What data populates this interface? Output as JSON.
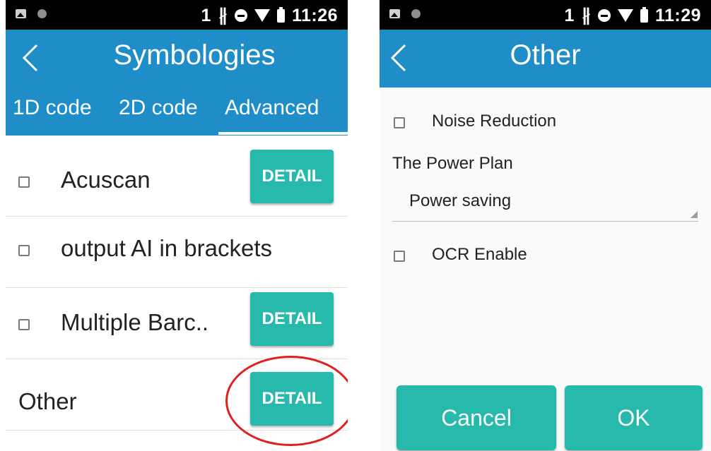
{
  "left": {
    "status": {
      "sim": "1",
      "time": "11:26"
    },
    "toolbar": {
      "title": "Symbologies"
    },
    "tabs": [
      "1D code",
      "2D code",
      "Advanced"
    ],
    "items": [
      {
        "label": "Acuscan",
        "has_checkbox": true,
        "button": "DETAIL"
      },
      {
        "label": "output AI in brackets",
        "has_checkbox": true,
        "button": ""
      },
      {
        "label": "Multiple Barc..",
        "has_checkbox": true,
        "button": "DETAIL"
      },
      {
        "label": "Other",
        "has_checkbox": false,
        "button": "DETAIL"
      }
    ],
    "highlight_color": "#e02020"
  },
  "right": {
    "status": {
      "sim": "1",
      "time": "11:29"
    },
    "toolbar": {
      "title": "Other"
    },
    "noise_reduction_label": "Noise Reduction",
    "power_plan_label": "The Power Plan",
    "power_plan_value": "Power saving",
    "ocr_label": "OCR Enable",
    "cancel_label": "Cancel",
    "ok_label": "OK"
  },
  "colors": {
    "primary": "#1f8ec8",
    "accent": "#28b9ad",
    "statusbar": "#000000"
  },
  "icons": [
    "image-icon",
    "dot-icon",
    "bluetooth-icon",
    "block-icon",
    "wifi-icon",
    "battery-icon",
    "back-arrow-icon",
    "checkbox-icon",
    "dropdown-arrow-icon"
  ]
}
